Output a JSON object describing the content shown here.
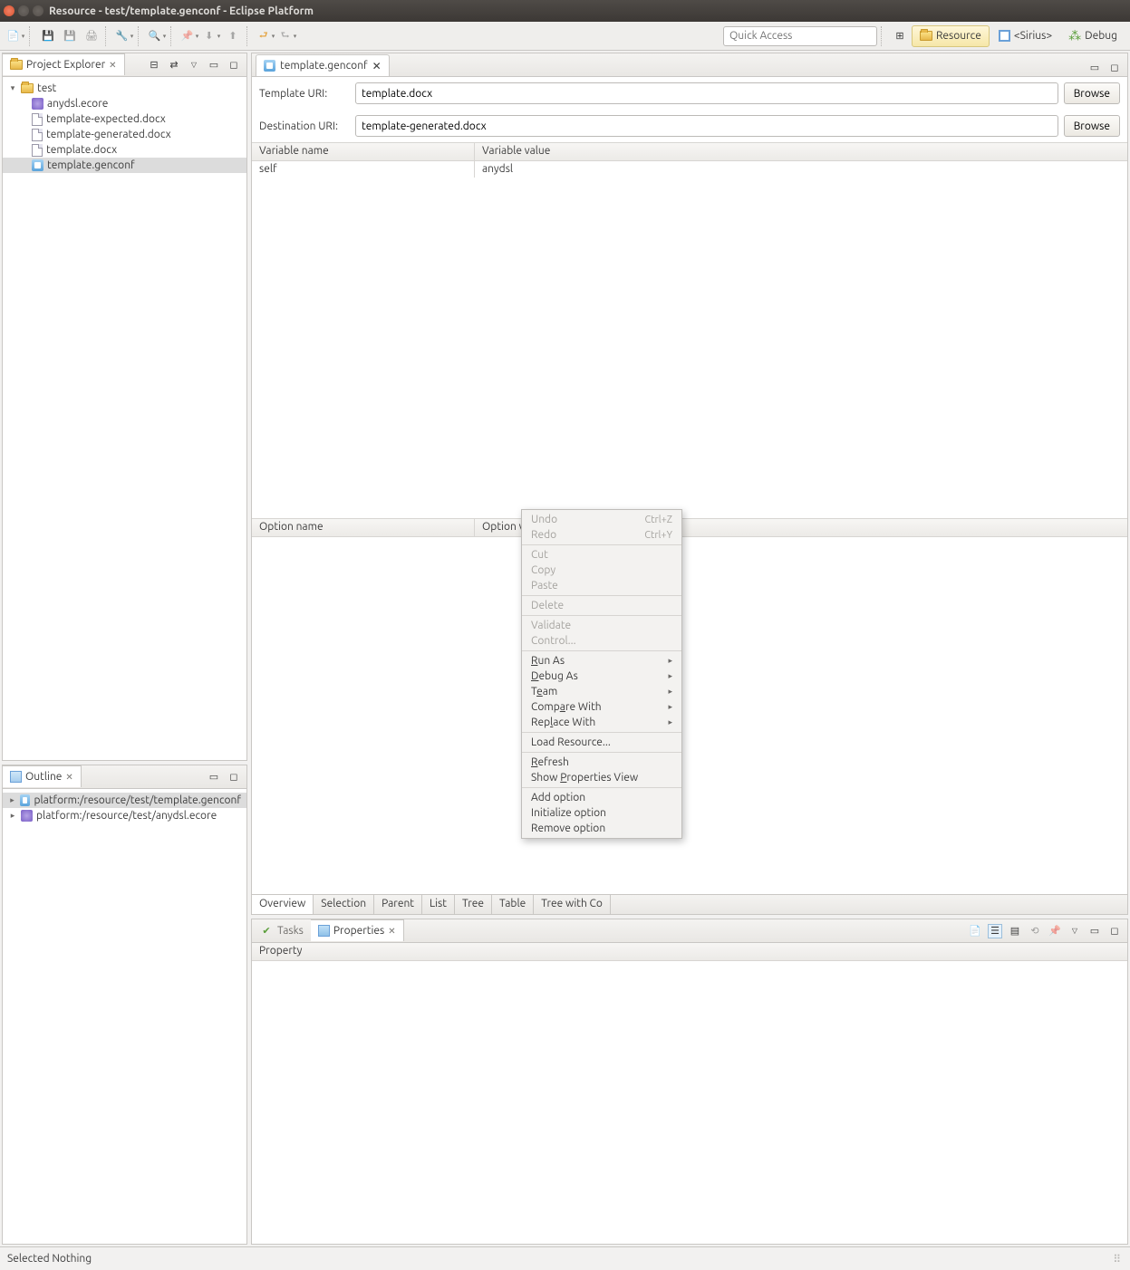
{
  "window": {
    "title": "Resource - test/template.genconf - Eclipse Platform"
  },
  "toolbar": {
    "quick_access_placeholder": "Quick Access",
    "perspectives": {
      "resource": "Resource",
      "sirius": "<Sirius>",
      "debug": "Debug"
    }
  },
  "project_explorer": {
    "title": "Project Explorer",
    "root": "test",
    "items": [
      {
        "label": "anydsl.ecore",
        "type": "pkg"
      },
      {
        "label": "template-expected.docx",
        "type": "file"
      },
      {
        "label": "template-generated.docx",
        "type": "file"
      },
      {
        "label": "template.docx",
        "type": "file"
      },
      {
        "label": "template.genconf",
        "type": "gen",
        "selected": true
      }
    ]
  },
  "outline": {
    "title": "Outline",
    "items": [
      "platform:/resource/test/template.genconf",
      "platform:/resource/test/anydsl.ecore"
    ]
  },
  "editor": {
    "tab": "template.genconf",
    "template_uri_label": "Template URI:",
    "template_uri_value": "template.docx",
    "destination_uri_label": "Destination URI:",
    "destination_uri_value": "template-generated.docx",
    "browse": "Browse",
    "var_table": {
      "headers": [
        "Variable name",
        "Variable value"
      ],
      "rows": [
        {
          "name": "self",
          "value": "anydsl"
        }
      ]
    },
    "opt_table": {
      "headers": [
        "Option name",
        "Option value"
      ]
    },
    "bottom_tabs": [
      "Overview",
      "Selection",
      "Parent",
      "List",
      "Tree",
      "Table",
      "Tree with Co"
    ]
  },
  "bottom_view": {
    "tasks": "Tasks",
    "properties": "Properties",
    "property_col": "Property"
  },
  "context_menu": {
    "undo": "Undo",
    "undo_key": "Ctrl+Z",
    "redo": "Redo",
    "redo_key": "Ctrl+Y",
    "cut": "Cut",
    "copy": "Copy",
    "paste": "Paste",
    "delete": "Delete",
    "validate": "Validate",
    "control": "Control...",
    "run_as": "Run As",
    "debug_as": "Debug As",
    "team": "Team",
    "compare_with": "Compare With",
    "replace_with": "Replace With",
    "load_resource": "Load Resource...",
    "refresh": "Refresh",
    "show_props": "Show Properties View",
    "add_option": "Add option",
    "init_option": "Initialize option",
    "remove_option": "Remove option"
  },
  "status": {
    "text": "Selected Nothing"
  }
}
